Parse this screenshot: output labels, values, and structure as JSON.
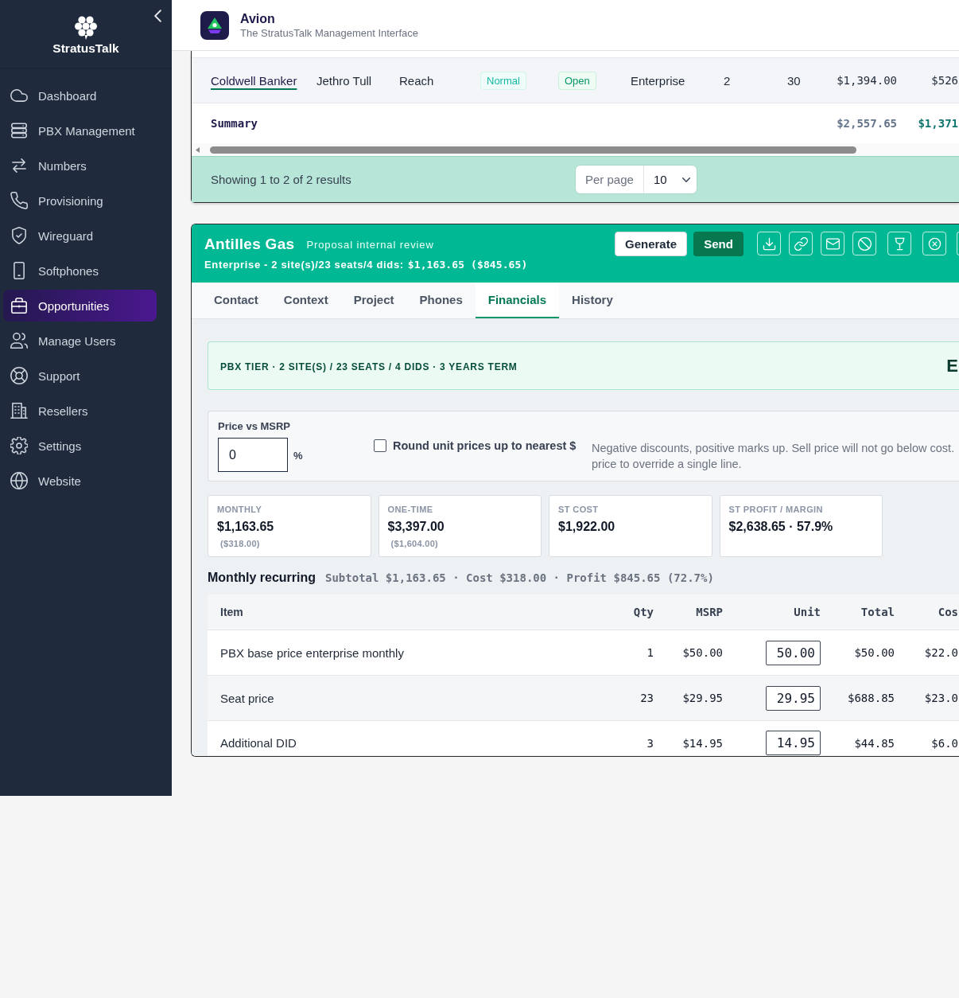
{
  "sidebar": {
    "brand": "StratusTalk",
    "items": [
      {
        "label": "Dashboard",
        "selected": false
      },
      {
        "label": "PBX Management",
        "selected": false
      },
      {
        "label": "Numbers",
        "selected": false
      },
      {
        "label": "Provisioning",
        "selected": false
      },
      {
        "label": "Wireguard",
        "selected": false
      },
      {
        "label": "Softphones",
        "selected": false
      },
      {
        "label": "Opportunities",
        "selected": true
      },
      {
        "label": "Manage Users",
        "selected": false
      },
      {
        "label": "Support",
        "selected": false
      },
      {
        "label": "Resellers",
        "selected": false
      },
      {
        "label": "Settings",
        "selected": false
      },
      {
        "label": "Website",
        "selected": false
      }
    ]
  },
  "header": {
    "title": "Avion",
    "subtitle": "The StratusTalk Management Interface"
  },
  "opportunity_list": {
    "rows": [
      {
        "cells": [
          "Coldwell Banker",
          "Jethro Tull",
          "Reach",
          "Normal",
          "Open",
          "Enterprise",
          "2",
          "30",
          "$1,394.00",
          "$526"
        ]
      }
    ],
    "summary": {
      "label": "Summary",
      "values": [
        "$2,557.65",
        "$1,371"
      ]
    },
    "results": "Showing 1 to 2 of 2 results",
    "per_page": {
      "label": "Per page",
      "value": "10"
    }
  },
  "opportunity": {
    "name": "Antilles Gas",
    "stage": "Proposal internal review",
    "summary": "Enterprise - 2 site(s)/23 seats/4 dids:",
    "summary_amount": "$1,163.65 ($845.65)",
    "actions": [
      {
        "label": "Generate",
        "kind": "secondary"
      },
      {
        "label": "Send",
        "kind": "primary"
      }
    ],
    "tabs": [
      {
        "label": "Contact",
        "selected": false
      },
      {
        "label": "Context",
        "selected": false
      },
      {
        "label": "Project",
        "selected": false
      },
      {
        "label": "Phones",
        "selected": false
      },
      {
        "label": "Financials",
        "selected": true
      },
      {
        "label": "History",
        "selected": false
      }
    ],
    "financials": {
      "tier_banner": {
        "text": "PBX TIER · 2 SITE(S) / 23 SEATS / 4 DIDS · 3 YEARS TERM",
        "column_2": "E"
      },
      "pricing": {
        "label": "Price vs MSRP",
        "value": "0",
        "unit": "%",
        "round_up": {
          "label": "Round unit prices up to nearest $",
          "checked": false
        },
        "hint_lines": [
          "Negative discounts, positive marks up. Sell price will not go below cost.",
          "price to override a single line."
        ]
      },
      "stats": [
        {
          "label": "MONTHLY",
          "value": "$1,163.65",
          "sub": "($318.00)"
        },
        {
          "label": "ONE-TIME",
          "value": "$3,397.00",
          "sub": "($1,604.00)"
        },
        {
          "label": "ST COST",
          "value": "$1,922.00"
        },
        {
          "label": "ST PROFIT / MARGIN",
          "value": "$2,638.65 · 57.9%"
        }
      ],
      "monthly_recurring": {
        "title": "Monthly recurring",
        "totals": "Subtotal $1,163.65 · Cost $318.00 · Profit $845.65 (72.7%)",
        "columns": [
          "Item",
          "Qty",
          "MSRP",
          "Unit",
          "Total",
          "Cos"
        ],
        "rows": [
          {
            "item": "PBX base price enterprise monthly",
            "qty": "1",
            "msrp": "$50.00",
            "unit": "50.00",
            "total": "$50.00",
            "column_6": "$22.0"
          },
          {
            "item": "Seat price",
            "qty": "23",
            "msrp": "$29.95",
            "unit": "29.95",
            "total": "$688.85",
            "column_6": "$23.0"
          },
          {
            "item": "Additional DID",
            "qty": "3",
            "msrp": "$14.95",
            "unit": "14.95",
            "total": "$44.85",
            "column_6": "$6.0"
          }
        ]
      }
    }
  }
}
